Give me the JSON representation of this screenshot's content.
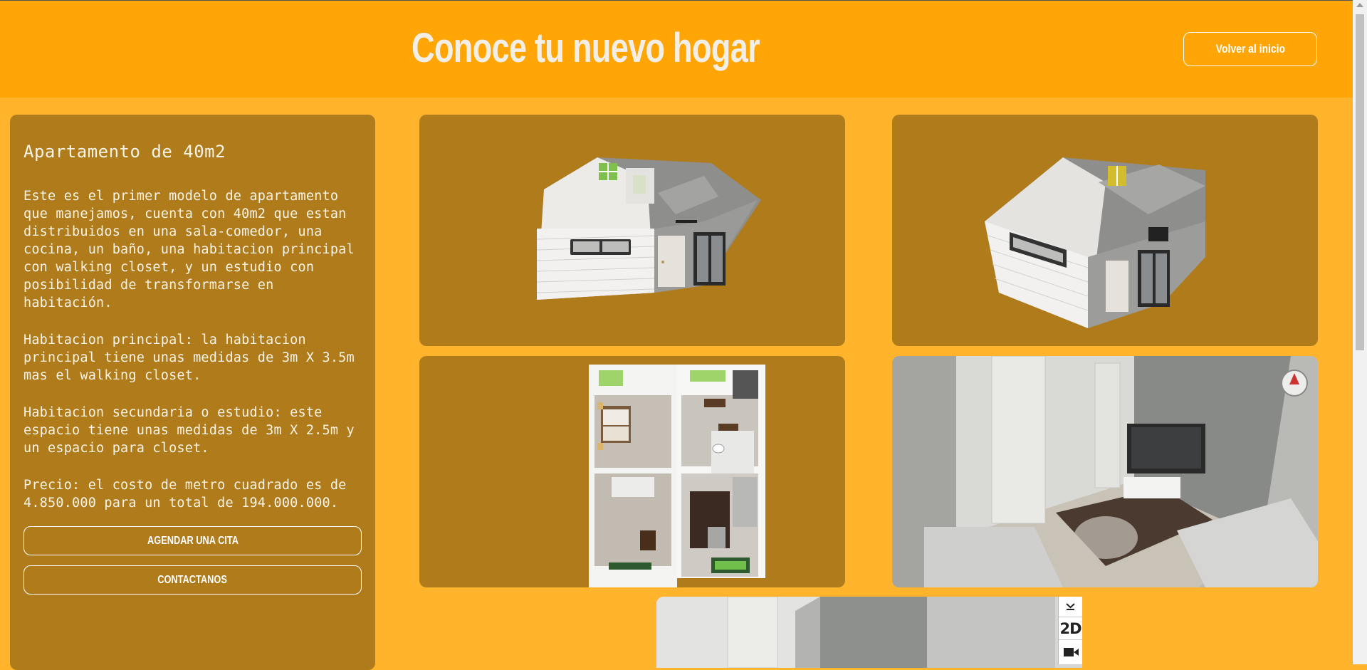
{
  "header": {
    "title": "Conoce tu nuevo hogar",
    "back_button": "Volver al inicio"
  },
  "info": {
    "title": "Apartamento de 40m2",
    "paragraphs": [
      "Este es el primer modelo de apartamento que manejamos, cuenta con 40m2 que estan distribuidos en una sala-comedor, una cocina, un baño, una habitacion principal con walking closet, y un estudio con posibilidad de transformarse en habitación.",
      "Habitacion principal: la habitacion principal tiene unas medidas de 3m X 3.5m mas el walking closet.",
      "Habitacion secundaria o estudio: este espacio tiene unas medidas de 3m X 2.5m y un espacio para closet.",
      "Precio: el costo de metro cuadrado es de 4.850.000 para un total de 194.000.000."
    ],
    "cta_primary": "AGENDAR UNA CITA",
    "cta_secondary": "CONTACTANOS"
  },
  "viewer": {
    "mode_label": "2D"
  },
  "colors": {
    "page_bg": "#ffb42c",
    "header_bg": "#ffa505",
    "card_bg": "#af7b1b",
    "text_light": "#fbf4e6"
  }
}
